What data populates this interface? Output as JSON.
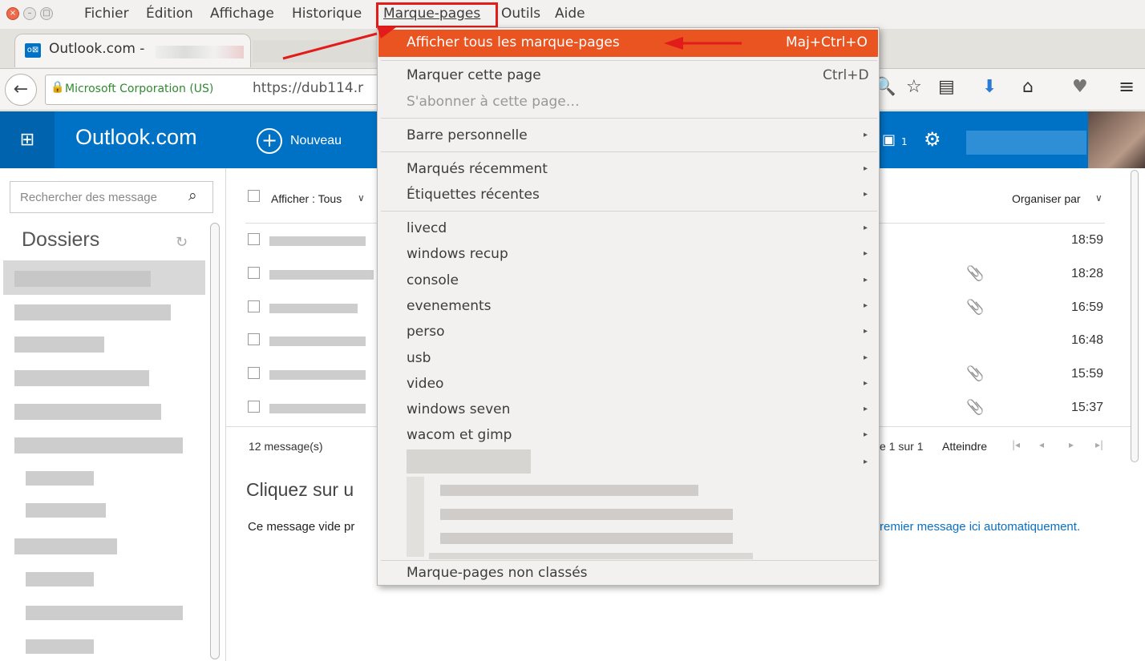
{
  "menubar": {
    "items": [
      "Fichier",
      "Édition",
      "Affichage",
      "Historique",
      "Marque-pages",
      "Outils",
      "Aide"
    ]
  },
  "tab": {
    "title": "Outlook.com -"
  },
  "urlbar": {
    "identity": "Microsoft Corporation (US)",
    "url": "https://dub114.r"
  },
  "outlook": {
    "brand": "Outlook.com",
    "new_label": "Nouveau",
    "chat_count": "1",
    "search_placeholder": "Rechercher des message",
    "folders_title": "Dossiers",
    "filter_label": "Afficher : Tous",
    "sort_label": "Organiser par",
    "times": [
      "18:59",
      "18:28",
      "16:59",
      "16:48",
      "15:59",
      "15:37"
    ],
    "attachments": [
      false,
      true,
      true,
      false,
      true,
      true
    ],
    "message_count": "12 message(s)",
    "pagination": "e 1 sur 1",
    "goto_label": "Atteindre",
    "empty_title": "Cliquez sur u",
    "empty_text_left": "Ce message vide pr",
    "empty_text_right": "remier message ici automatiquement."
  },
  "dropdown": {
    "show_all": {
      "label": "Afficher tous les marque-pages",
      "shortcut": "Maj+Ctrl+O"
    },
    "bookmark_page": {
      "label": "Marquer cette page",
      "shortcut": "Ctrl+D"
    },
    "subscribe": "S'abonner à cette page…",
    "toolbar": "Barre personnelle",
    "recent_bookmarks": "Marqués récemment",
    "recent_tags": "Étiquettes récentes",
    "folders": [
      "livecd",
      "windows recup",
      "console",
      "evenements",
      "perso",
      "usb",
      "video",
      "windows seven",
      "wacom et gimp"
    ],
    "unsorted": "Marque-pages non classés"
  },
  "colors": {
    "accent": "#e95420",
    "outlook_blue": "#0072c6",
    "annotation": "#e21b1b"
  }
}
